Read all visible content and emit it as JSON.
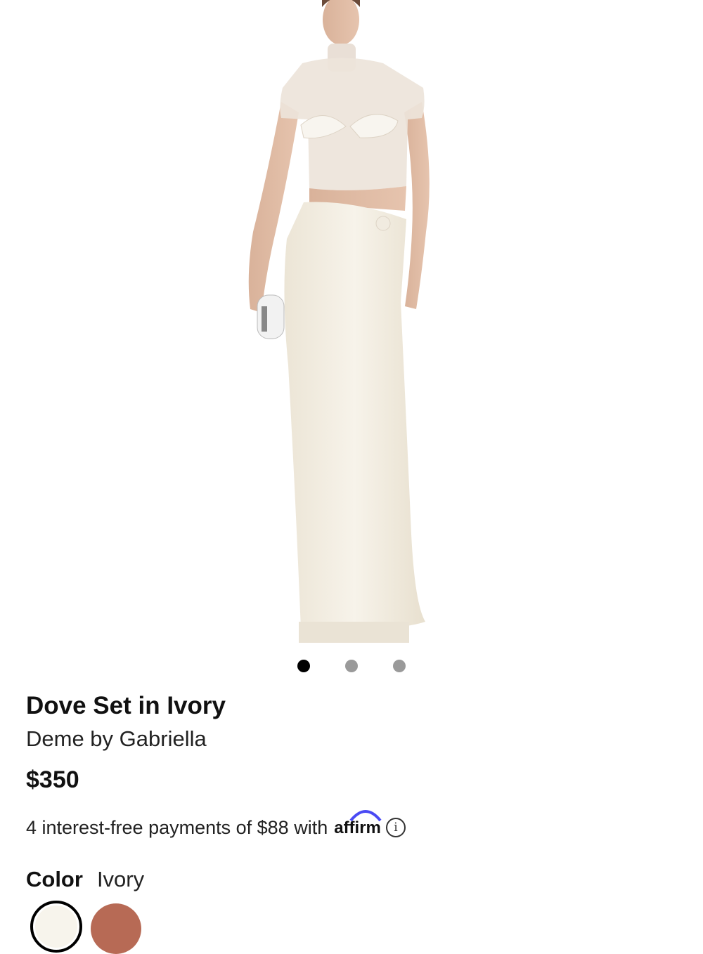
{
  "product": {
    "title": "Dove Set in Ivory",
    "brand": "Deme by Gabriella",
    "price": "$350",
    "image_alt": "Model wearing ivory mesh top and draped maxi skirt"
  },
  "carousel": {
    "total_slides": 3,
    "active_slide": 1
  },
  "financing": {
    "text": "4 interest-free payments of $88 with",
    "provider_logo": "affirm",
    "info_icon": "info-circle-icon"
  },
  "color": {
    "label": "Color",
    "selected_value": "Ivory",
    "options": [
      {
        "name": "Ivory",
        "hex": "#f7f4ec",
        "selected": true
      },
      {
        "name": "Brown",
        "hex": "#b76a55",
        "selected": false
      }
    ]
  },
  "theme": {
    "accent": "#4a4af4",
    "text": "#111111",
    "dot_active": "#000000",
    "dot_inactive": "#9a9a9a"
  }
}
